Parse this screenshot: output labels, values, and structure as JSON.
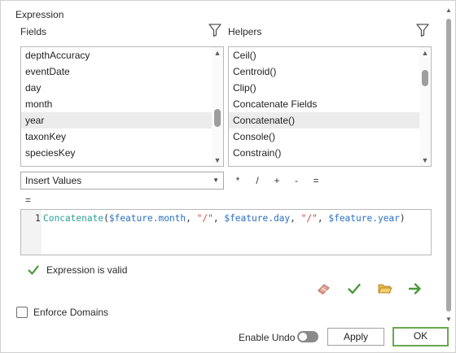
{
  "panel": {
    "title": "Expression"
  },
  "fields": {
    "label": "Fields",
    "filter_icon": "funnel-icon",
    "items": [
      "depthAccuracy",
      "eventDate",
      "day",
      "month",
      "year",
      "taxonKey",
      "speciesKey"
    ],
    "selected": "year"
  },
  "helpers": {
    "label": "Helpers",
    "filter_icon": "funnel-icon",
    "items": [
      "Ceil()",
      "Centroid()",
      "Clip()",
      "Concatenate Fields",
      "Concatenate()",
      "Console()",
      "Constrain()"
    ],
    "selected": "Concatenate()"
  },
  "insert": {
    "value": "Insert Values"
  },
  "operators": [
    "*",
    "/",
    "+",
    "-",
    "=",
    "="
  ],
  "editor": {
    "line_number": "1",
    "tokens": [
      {
        "t": "Concatenate",
        "c": "fn"
      },
      {
        "t": "(",
        "c": "punct"
      },
      {
        "t": "$feature.month",
        "c": "kw"
      },
      {
        "t": ", ",
        "c": "punct"
      },
      {
        "t": "\"/\"",
        "c": "str"
      },
      {
        "t": ", ",
        "c": "punct"
      },
      {
        "t": "$feature.day",
        "c": "kw"
      },
      {
        "t": ", ",
        "c": "punct"
      },
      {
        "t": "\"/\"",
        "c": "str"
      },
      {
        "t": ", ",
        "c": "punct"
      },
      {
        "t": "$feature.year",
        "c": "kw"
      },
      {
        "t": ")",
        "c": "punct"
      }
    ]
  },
  "validation": {
    "message": "Expression is valid",
    "icon": "check-icon",
    "color": "#4a9a3a"
  },
  "toolbar_icons": [
    "eraser-icon",
    "verify-check-icon",
    "open-folder-icon",
    "run-arrow-icon"
  ],
  "enforce_domains": {
    "label": "Enforce Domains",
    "checked": false
  },
  "footer": {
    "undo_label": "Enable Undo",
    "undo_enabled": false,
    "apply_label": "Apply",
    "ok_label": "OK"
  },
  "colors": {
    "ok_border": "#6aa84f",
    "selection": "#ececec",
    "function": "#2aa198",
    "keyword": "#2b6fc2",
    "string": "#d04545"
  }
}
